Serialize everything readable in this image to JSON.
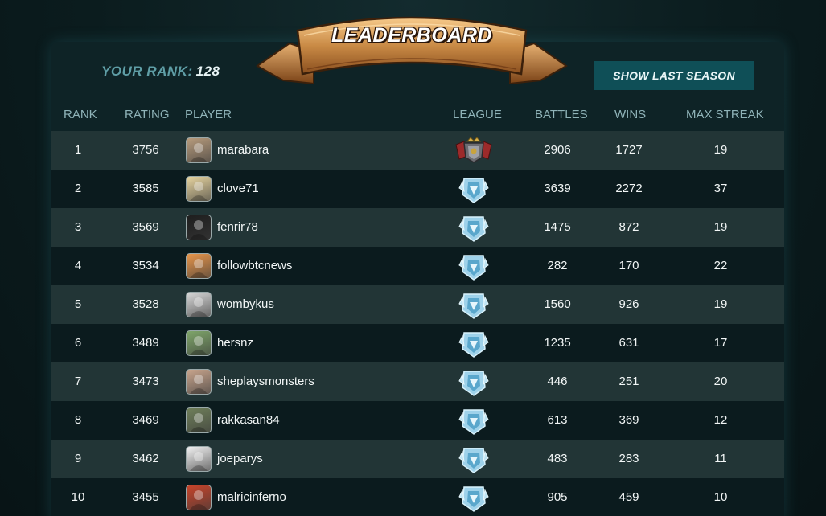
{
  "banner": {
    "title": "LEADERBOARD"
  },
  "your_rank": {
    "label": "YOUR RANK:",
    "value": "128"
  },
  "season_button": {
    "label": "SHOW LAST SEASON"
  },
  "columns": {
    "rank": "RANK",
    "rating": "RATING",
    "player": "PLAYER",
    "league": "LEAGUE",
    "battles": "BATTLES",
    "wins": "WINS",
    "max_streak": "MAX STREAK"
  },
  "colors": {
    "accent": "#0f4f57",
    "rank_label": "#5f9ea6",
    "header_text": "#8fb3b8",
    "row_light": "#223536",
    "row_dark": "#0b1b1e"
  },
  "rows": [
    {
      "rank": "1",
      "rating": "3756",
      "player": "marabara",
      "league_icon": "champion-league-icon",
      "battles": "2906",
      "wins": "1727",
      "max_streak": "19",
      "avatar_color": "#b89c7d"
    },
    {
      "rank": "2",
      "rating": "3585",
      "player": "clove71",
      "league_icon": "diamond-league-icon",
      "battles": "3639",
      "wins": "2272",
      "max_streak": "37",
      "avatar_color": "#e8d5a0"
    },
    {
      "rank": "3",
      "rating": "3569",
      "player": "fenrir78",
      "league_icon": "diamond-league-icon",
      "battles": "1475",
      "wins": "872",
      "max_streak": "19",
      "avatar_color": "#1e1e1e"
    },
    {
      "rank": "4",
      "rating": "3534",
      "player": "followbtcnews",
      "league_icon": "diamond-league-icon",
      "battles": "282",
      "wins": "170",
      "max_streak": "22",
      "avatar_color": "#e8954a"
    },
    {
      "rank": "5",
      "rating": "3528",
      "player": "wombykus",
      "league_icon": "diamond-league-icon",
      "battles": "1560",
      "wins": "926",
      "max_streak": "19",
      "avatar_color": "#d8d8d8"
    },
    {
      "rank": "6",
      "rating": "3489",
      "player": "hersnz",
      "league_icon": "diamond-league-icon",
      "battles": "1235",
      "wins": "631",
      "max_streak": "17",
      "avatar_color": "#7fa66a"
    },
    {
      "rank": "7",
      "rating": "3473",
      "player": "sheplaysmonsters",
      "league_icon": "diamond-league-icon",
      "battles": "446",
      "wins": "251",
      "max_streak": "20",
      "avatar_color": "#c9a58d"
    },
    {
      "rank": "8",
      "rating": "3469",
      "player": "rakkasan84",
      "league_icon": "diamond-league-icon",
      "battles": "613",
      "wins": "369",
      "max_streak": "12",
      "avatar_color": "#6f7f5a"
    },
    {
      "rank": "9",
      "rating": "3462",
      "player": "joeparys",
      "league_icon": "diamond-league-icon",
      "battles": "483",
      "wins": "283",
      "max_streak": "11",
      "avatar_color": "#f2f2f2"
    },
    {
      "rank": "10",
      "rating": "3455",
      "player": "malricinferno",
      "league_icon": "diamond-league-icon",
      "battles": "905",
      "wins": "459",
      "max_streak": "10",
      "avatar_color": "#c8442a"
    }
  ]
}
